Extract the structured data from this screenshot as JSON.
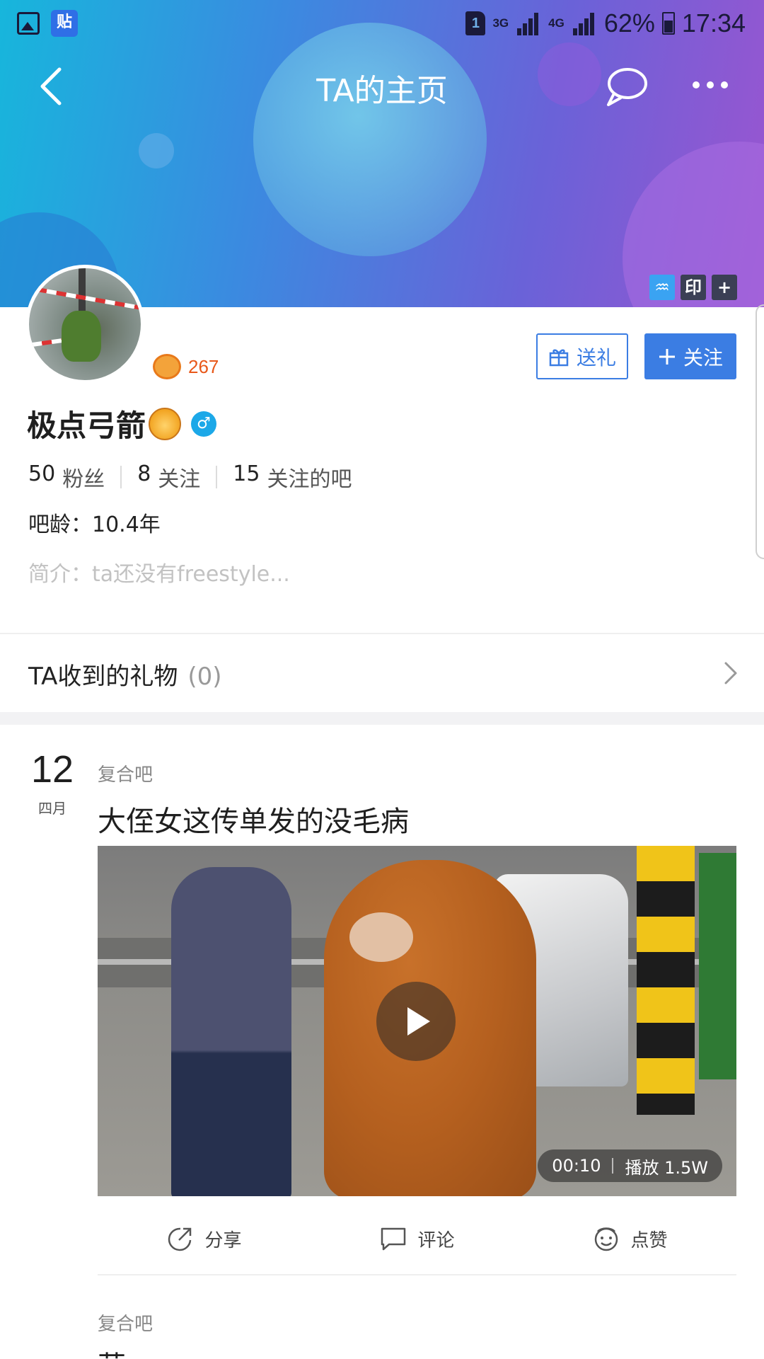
{
  "status_bar": {
    "tieba_icon_label": "贴",
    "sim_label": "1",
    "net1": "3G",
    "net2": "4G",
    "battery": "62%",
    "time": "17:34"
  },
  "header": {
    "title": "TA的主页",
    "back_icon": "chevron-left-icon",
    "chat_icon": "chat-bubble-icon",
    "more_icon": "more-dots-icon"
  },
  "banner_badges": {
    "zodiac": "♒",
    "seal": "印",
    "plus": "+"
  },
  "profile": {
    "level": "267",
    "name": "极点弓箭",
    "gift_button": "送礼",
    "follow_button": "关注",
    "stats": [
      {
        "num": "50",
        "label": "粉丝"
      },
      {
        "num": "8",
        "label": "关注"
      },
      {
        "num": "15",
        "label": "关注的吧"
      }
    ],
    "age": "吧龄：10.4年",
    "intro": "简介：ta还没有freestyle..."
  },
  "gifts": {
    "title": "TA收到的礼物",
    "count": "(0)"
  },
  "post": {
    "day": "12",
    "month": "四月",
    "forum": "复合吧",
    "title": "大侄女这传单发的没毛病",
    "video_duration": "00:10",
    "video_plays": "播放 1.5W",
    "actions": {
      "share": "分享",
      "comment": "评论",
      "like": "点赞"
    }
  },
  "post2": {
    "forum": "复合吧",
    "title": "草"
  },
  "colors": {
    "accent": "#3b7de3",
    "level": "#e8581a",
    "banner_start": "#17b6dc",
    "banner_end": "#9a55d0"
  }
}
